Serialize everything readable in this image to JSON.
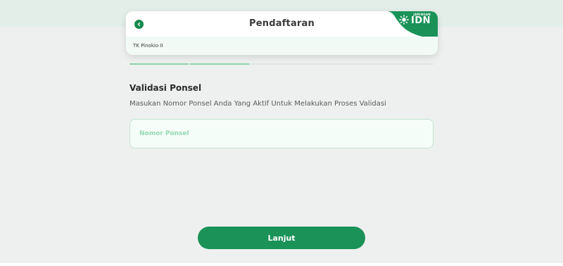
{
  "header": {
    "title": "Pendaftaran",
    "school_name": "TK Pinokio II",
    "brand": {
      "small_text": "JARINGAN",
      "main_text": "IDN",
      "color": "#1a9258"
    }
  },
  "progress": {
    "completed_steps": 2,
    "accent_color": "#8fd1ad"
  },
  "form": {
    "section_title": "Validasi Ponsel",
    "description": "Masukan Nomor Ponsel Anda Yang Aktif Untuk Melakukan Proses Validasi",
    "phone_placeholder": "Nomor Ponsel",
    "phone_value": ""
  },
  "actions": {
    "submit_label": "Lanjut"
  },
  "icons": {
    "back": "chevron-left-icon",
    "brand": "sun-icon"
  }
}
